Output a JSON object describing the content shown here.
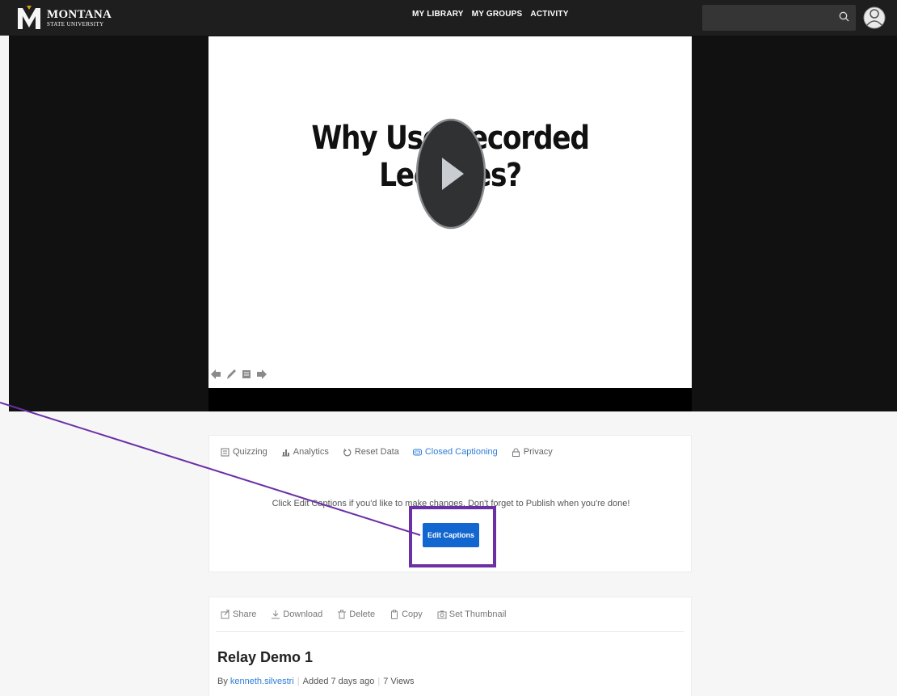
{
  "header": {
    "logo": {
      "title": "MONTANA",
      "subtitle": "STATE UNIVERSITY"
    },
    "nav": [
      "MY LIBRARY",
      "MY GROUPS",
      "ACTIVITY"
    ],
    "search_icon": "search-icon",
    "avatar_icon": "user-avatar-icon"
  },
  "video": {
    "slide_title": "Why Use Recorded Lectures?",
    "play_icon": "play-icon",
    "slide_tools": [
      "arrow-left-icon",
      "pen-icon",
      "notes-icon",
      "arrow-right-icon"
    ]
  },
  "panel": {
    "tabs": [
      {
        "label": "Quizzing",
        "icon": "quiz-icon",
        "active": false
      },
      {
        "label": "Analytics",
        "icon": "chart-icon",
        "active": false
      },
      {
        "label": "Reset Data",
        "icon": "reset-icon",
        "active": false
      },
      {
        "label": "Closed Captioning",
        "icon": "captions-icon",
        "active": true
      },
      {
        "label": "Privacy",
        "icon": "lock-icon",
        "active": false
      }
    ],
    "hint": "Click Edit Captions if you'd like to make changes. Don't forget to Publish when you're done!",
    "button": "Edit Captions"
  },
  "details": {
    "actions": [
      {
        "label": "Share",
        "icon": "share-icon"
      },
      {
        "label": "Download",
        "icon": "download-icon"
      },
      {
        "label": "Delete",
        "icon": "trash-icon"
      },
      {
        "label": "Copy",
        "icon": "copy-icon"
      },
      {
        "label": "Set Thumbnail",
        "icon": "camera-icon"
      }
    ],
    "title": "Relay Demo 1",
    "by": "By",
    "author": "kenneth.silvestri",
    "added": "Added 7 days ago",
    "views": "7 Views"
  },
  "annotation": {
    "color": "#6b2fa6"
  }
}
